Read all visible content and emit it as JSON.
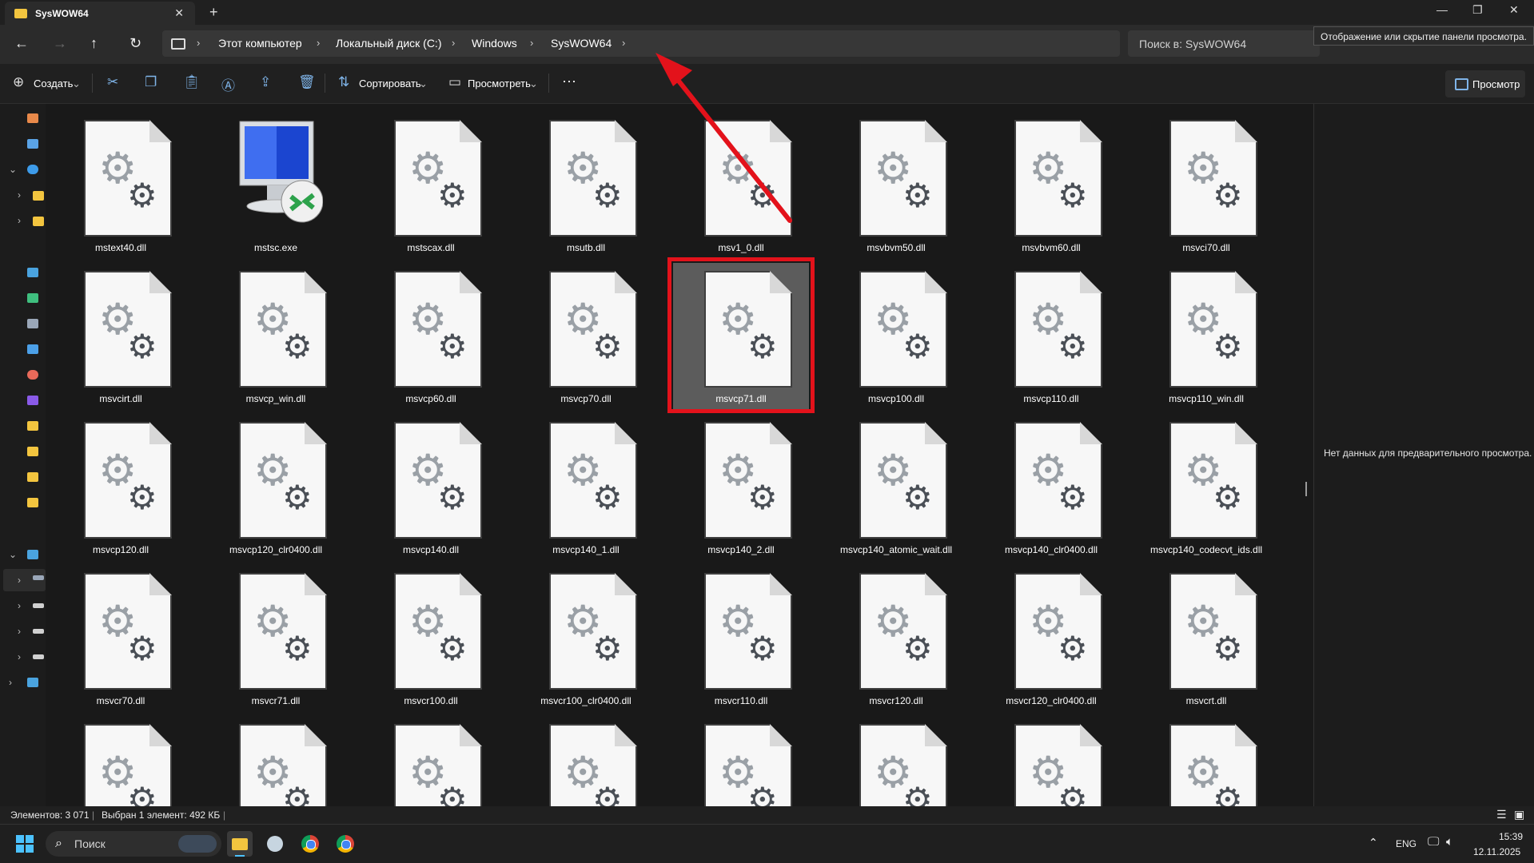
{
  "window": {
    "tab_title": "SysWOW64"
  },
  "nav": {
    "breadcrumbs": [
      "Этот компьютер",
      "Локальный диск (C:)",
      "Windows",
      "SysWOW64"
    ]
  },
  "search": {
    "placeholder": "Поиск в: SysWOW64"
  },
  "tooltip": "Отображение или скрытие панели просмотра.",
  "toolbar": {
    "create": "Создать",
    "sort": "Сортировать",
    "view": "Просмотреть",
    "preview": "Просмотр"
  },
  "files": [
    "mstext40.dll",
    "mstsc.exe",
    "mstscax.dll",
    "msutb.dll",
    "msv1_0.dll",
    "msvbvm50.dll",
    "msvbvm60.dll",
    "msvci70.dll",
    "msvcirt.dll",
    "msvcp_win.dll",
    "msvcp60.dll",
    "msvcp70.dll",
    "msvcp71.dll",
    "msvcp100.dll",
    "msvcp110.dll",
    "msvcp110_win.dll",
    "msvcp120.dll",
    "msvcp120_clr0400.dll",
    "msvcp140.dll",
    "msvcp140_1.dll",
    "msvcp140_2.dll",
    "msvcp140_atomic_wait.dll",
    "msvcp140_clr0400.dll",
    "msvcp140_codecvt_ids.dll",
    "msvcr70.dll",
    "msvcr71.dll",
    "msvcr100.dll",
    "msvcr100_clr0400.dll",
    "msvcr110.dll",
    "msvcr120.dll",
    "msvcr120_clr0400.dll",
    "msvcrt.dll",
    "",
    "",
    "",
    "",
    "",
    "",
    "",
    ""
  ],
  "selected_file": "msvcp71.dll",
  "preview_pane": {
    "message": "Нет данных для предварительного просмотра."
  },
  "status": {
    "count": "Элементов: 3 071",
    "selection": "Выбран 1 элемент: 492 КБ"
  },
  "taskbar": {
    "search": "Поиск",
    "lang": "ENG",
    "time": "15:39",
    "date": "12.11.2025"
  },
  "colors": {
    "accent": "#e3121b",
    "selection_bg": "#5c5c5c",
    "folder": "#f3c53f"
  }
}
